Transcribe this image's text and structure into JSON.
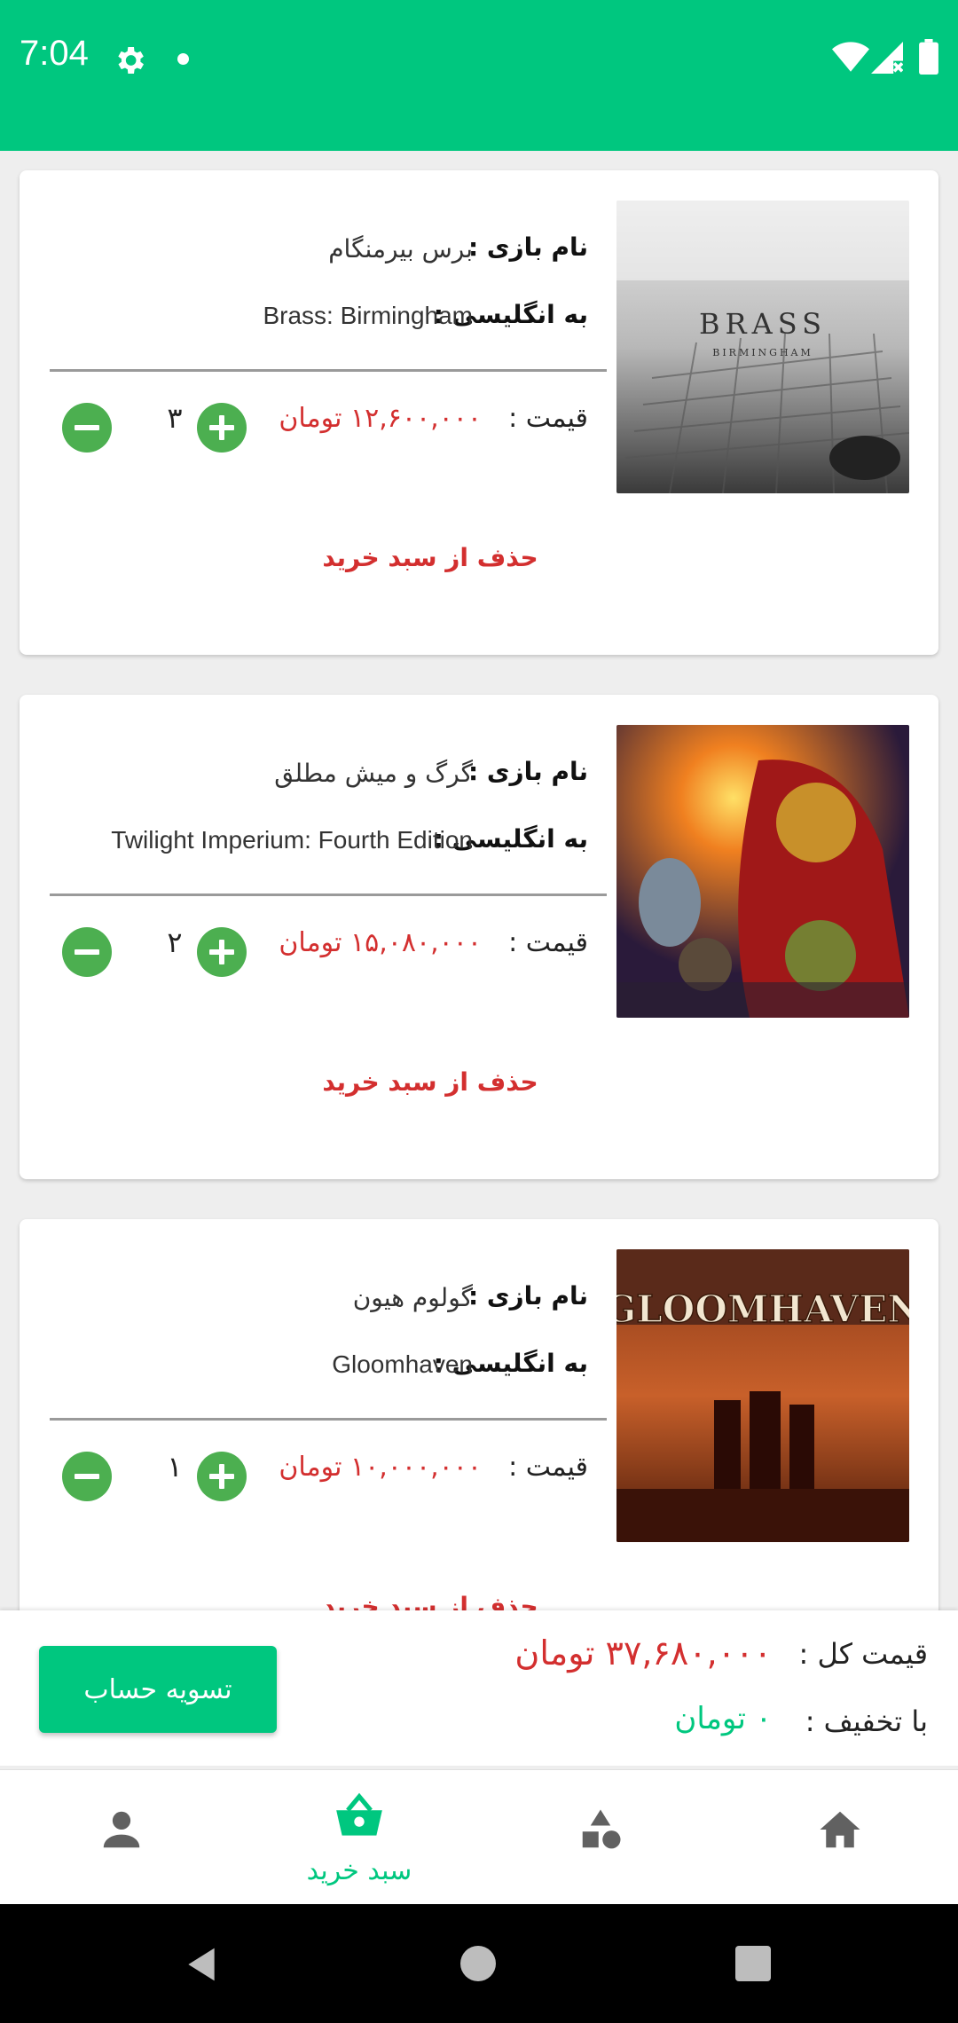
{
  "status_bar": {
    "time": "7:04"
  },
  "labels": {
    "name_label": "نام بازی :",
    "english_label": "به انگلیسی :",
    "price_label": "قیمت :",
    "remove_label": "حذف از سبد خرید"
  },
  "cart_items": [
    {
      "name_fa": "برس بیرمنگام",
      "name_en": "Brass: Birmingham",
      "price": "۱۲,۶۰۰,۰۰۰ تومان",
      "quantity": "۳",
      "image": "brass-birmingham-cover",
      "image_title": "BRASS",
      "image_subtitle": "BIRMINGHAM"
    },
    {
      "name_fa": "گرگ و میش مطلق",
      "name_en": "Twilight Imperium: Fourth Edition",
      "price": "۱۵,۰۸۰,۰۰۰ تومان",
      "quantity": "۲",
      "image": "twilight-imperium-cover"
    },
    {
      "name_fa": "گولوم هیون",
      "name_en": "Gloomhaven",
      "price": "۱۰,۰۰۰,۰۰۰ تومان",
      "quantity": "۱",
      "image": "gloomhaven-cover",
      "image_title": "GLOOMHAVEN"
    }
  ],
  "summary": {
    "total_label": "قیمت کل :",
    "total_value": "۳۷,۶۸۰,۰۰۰ تومان",
    "discount_label": "با تخفیف :",
    "discount_value": "۰ تومان",
    "checkout_label": "تسویه حساب"
  },
  "bottom_nav": {
    "active": "cart",
    "cart_label": "سبد خرید",
    "items": [
      "profile-icon",
      "cart-icon",
      "categories-icon",
      "home-icon"
    ]
  },
  "colors": {
    "primary": "#00c77f",
    "price_red": "#d32f2f",
    "stepper_green": "#4caf50"
  }
}
